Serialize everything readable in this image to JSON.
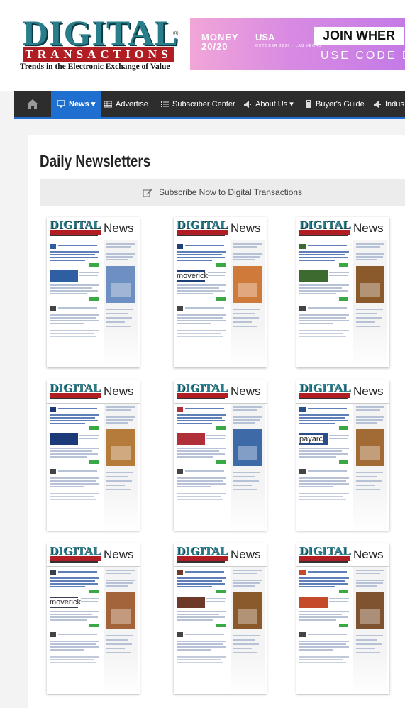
{
  "header": {
    "logo_word": "DIGITAL",
    "logo_reg": "®",
    "logo_bar": "TRANSACTIONS",
    "tagline": "Trends in the Electronic Exchange of Value"
  },
  "banner": {
    "money_line1": "MONEY",
    "money_line2": "20/20",
    "usa": "USA",
    "event_sub": "OCTOBER 2026 · LAS VEGAS",
    "join": "JOIN WHER",
    "code": "USE CODE D"
  },
  "nav": {
    "home_icon": "home-icon",
    "items": [
      {
        "label": "News ▾",
        "icon": "monitor-icon",
        "active": true
      },
      {
        "label": "Advertise",
        "icon": "grid-icon"
      },
      {
        "label": "Subscriber Center",
        "icon": "list-icon"
      },
      {
        "label": "About Us ▾",
        "icon": "megaphone-icon"
      },
      {
        "label": "Buyer's Guide",
        "icon": "book-icon"
      },
      {
        "label": "Indus",
        "icon": "megaphone-icon"
      }
    ],
    "colors": {
      "bar": "#2d2d2d",
      "active": "#1f6fd1"
    }
  },
  "page": {
    "title": "Daily Newsletters",
    "subscribe_label": "Subscribe Now to Digital Transactions"
  },
  "newsletter_card": {
    "logo_word": "DIGITAL",
    "news_label": "News"
  },
  "newsletters": [
    {
      "brand": ""
    },
    {
      "brand": "moverick"
    },
    {
      "brand": ""
    },
    {
      "brand": ""
    },
    {
      "brand": ""
    },
    {
      "brand": "payarc"
    },
    {
      "brand": "moverick"
    },
    {
      "brand": ""
    },
    {
      "brand": ""
    }
  ]
}
